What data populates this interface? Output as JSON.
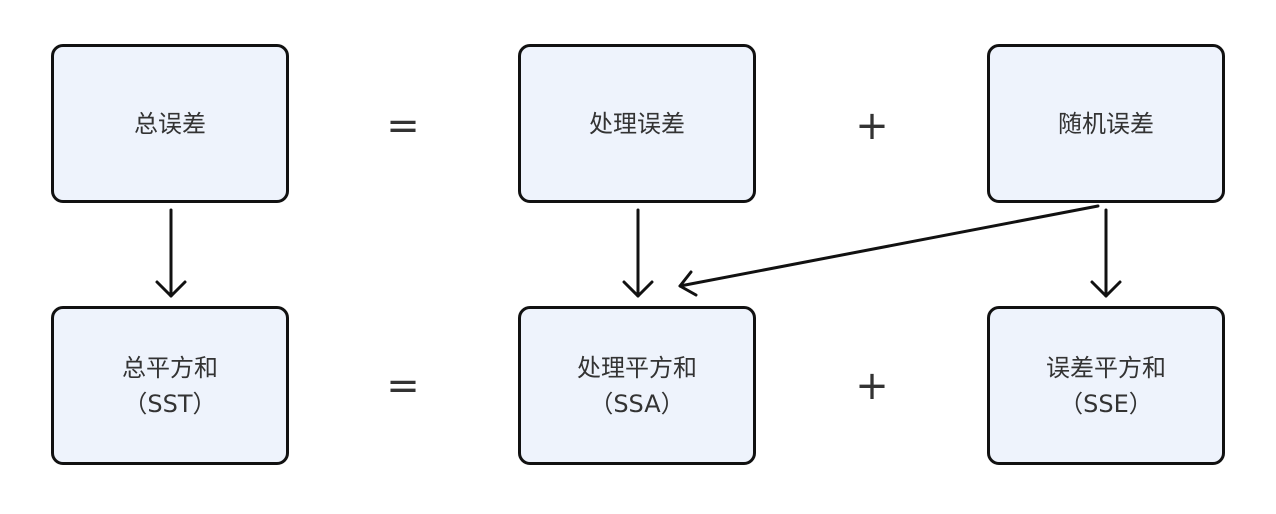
{
  "colors": {
    "node_fill": "#eef3fc",
    "node_border": "#111111",
    "text": "#333333",
    "arrow": "#111111"
  },
  "nodes": {
    "total_error": {
      "label": "总误差"
    },
    "treatment_error": {
      "label": "处理误差"
    },
    "random_error": {
      "label": "随机误差"
    },
    "sst": {
      "label": "总平方和",
      "sub": "（SST）"
    },
    "ssa": {
      "label": "处理平方和",
      "sub": "（SSA）"
    },
    "sse": {
      "label": "误差平方和",
      "sub": "（SSE）"
    }
  },
  "operators": {
    "top_equals": "=",
    "top_plus": "+",
    "bottom_equals": "=",
    "bottom_plus": "+"
  },
  "edges": [
    {
      "from": "总误差",
      "to": "总平方和"
    },
    {
      "from": "处理误差",
      "to": "处理平方和"
    },
    {
      "from": "随机误差",
      "to": "处理平方和"
    },
    {
      "from": "随机误差",
      "to": "误差平方和"
    }
  ]
}
